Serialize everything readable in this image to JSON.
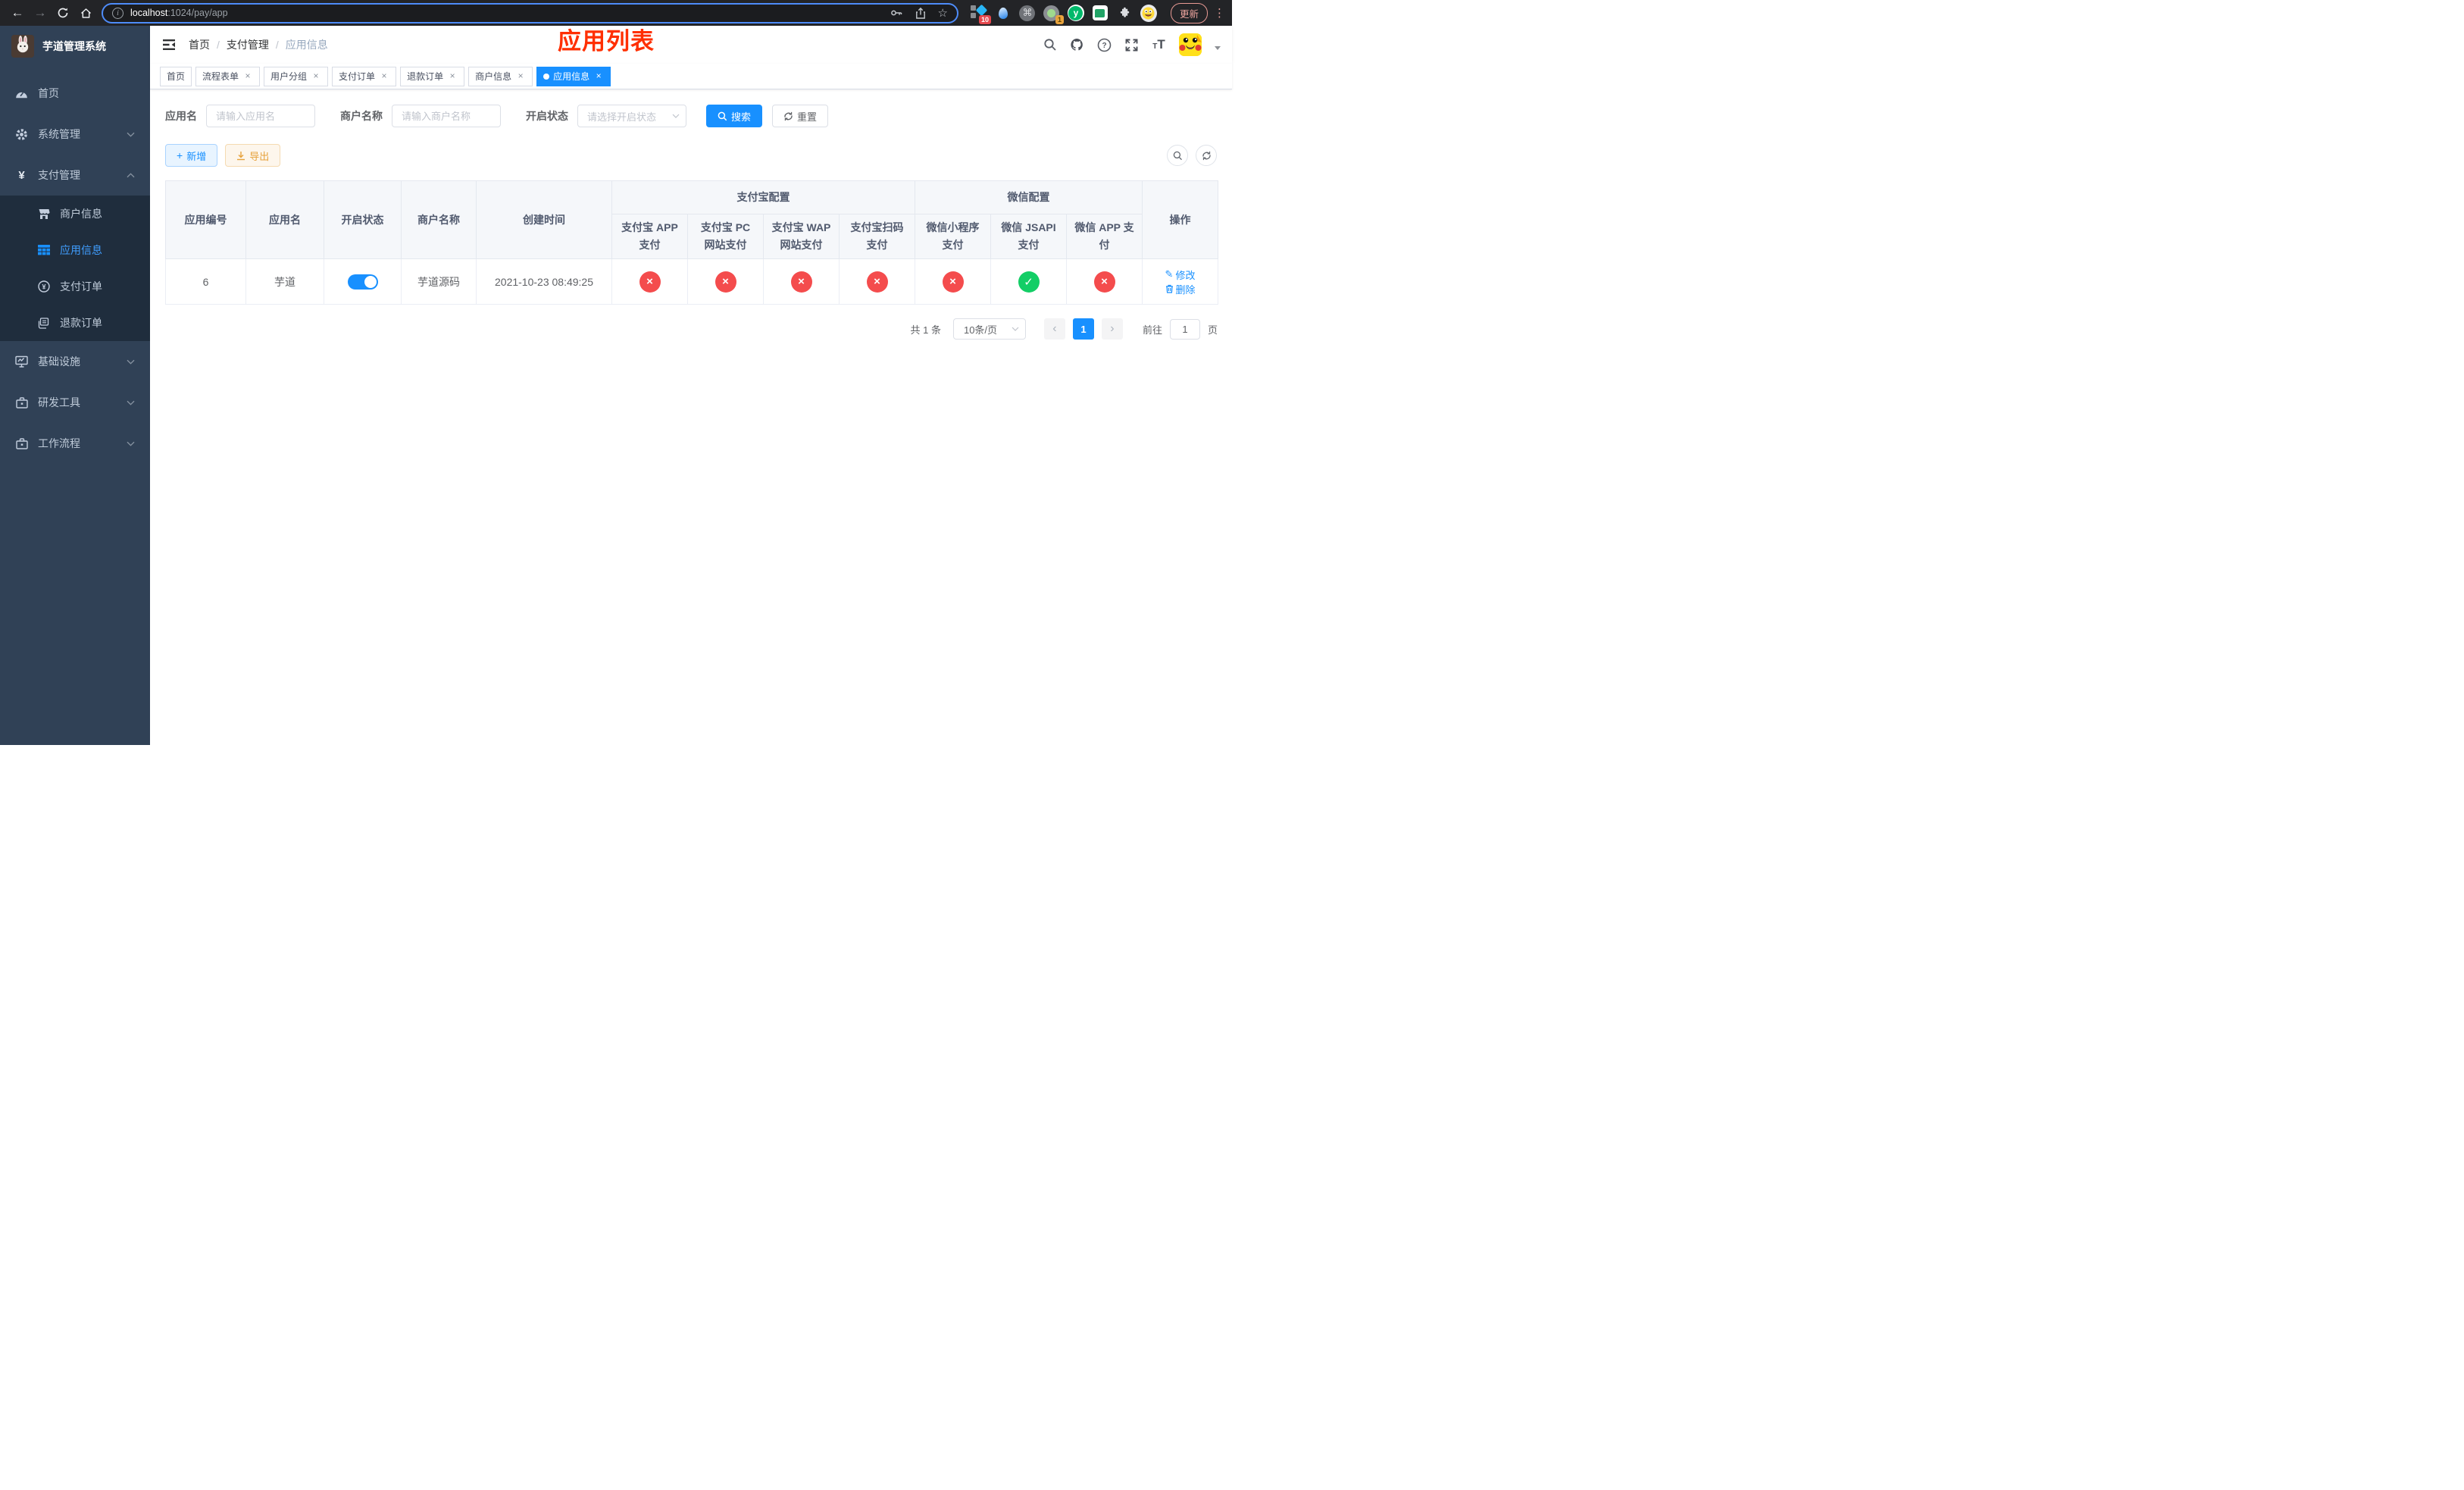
{
  "colors": {
    "accent": "#1890ff",
    "sidebar_bg": "#304156",
    "submenu_bg": "#1f2d3d",
    "danger": "#f44c4d",
    "success": "#13ce66",
    "warning": "#e6a23c",
    "overlay_title_red": "#ff2f00"
  },
  "browser": {
    "url_host": "localhost",
    "url_path": ":1024/pay/app",
    "update_label": "更新",
    "ext_badge_count": "10",
    "ext_dot_count": "1",
    "ext_y_label": "y"
  },
  "sidebar": {
    "title": "芋道管理系统",
    "items": [
      {
        "label": "首页"
      },
      {
        "label": "系统管理"
      },
      {
        "label": "支付管理"
      },
      {
        "label": "基础设施"
      },
      {
        "label": "研发工具"
      },
      {
        "label": "工作流程"
      }
    ],
    "submenu": [
      {
        "label": "商户信息"
      },
      {
        "label": "应用信息"
      },
      {
        "label": "支付订单"
      },
      {
        "label": "退款订单"
      }
    ]
  },
  "navbar": {
    "breadcrumb": [
      {
        "label": "首页"
      },
      {
        "label": "支付管理"
      },
      {
        "label": "应用信息"
      }
    ],
    "overlay_title": "应用列表"
  },
  "tags": [
    {
      "label": "首页"
    },
    {
      "label": "流程表单"
    },
    {
      "label": "用户分组"
    },
    {
      "label": "支付订单"
    },
    {
      "label": "退款订单"
    },
    {
      "label": "商户信息"
    },
    {
      "label": "应用信息"
    }
  ],
  "icons": {
    "close": "×",
    "cross": "×",
    "check": "✓",
    "prev": "‹",
    "next": "›",
    "back": "←",
    "forward": "→",
    "star": "☆",
    "command": "⌘",
    "kebab": "⋮",
    "plus": "＋",
    "info": "i",
    "question": "?",
    "edit": "✎"
  },
  "filter": {
    "app_name_label": "应用名",
    "app_name_placeholder": "请输入应用名",
    "merchant_label": "商户名称",
    "merchant_placeholder": "请输入商户名称",
    "status_label": "开启状态",
    "status_placeholder": "请选择开启状态",
    "search_label": "搜索",
    "reset_label": "重置"
  },
  "toolbar": {
    "add_label": "新增",
    "export_label": "导出"
  },
  "table": {
    "columns": {
      "id": "应用编号",
      "name": "应用名",
      "status": "开启状态",
      "merchant": "商户名称",
      "created": "创建时间",
      "alipay_group": "支付宝配置",
      "wechat_group": "微信配置",
      "actions": "操作",
      "alipay_app": "支付宝 APP 支付",
      "alipay_pc": "支付宝 PC 网站支付",
      "alipay_wap": "支付宝 WAP 网站支付",
      "alipay_qr": "支付宝扫码支付",
      "wx_lite": "微信小程序支付",
      "wx_jsapi": "微信 JSAPI 支付",
      "wx_app": "微信 APP 支付"
    },
    "row": {
      "id": "6",
      "name": "芋道",
      "switch_on": true,
      "merchant": "芋道源码",
      "created": "2021-10-23 08:49:25",
      "status_icons": [
        "×",
        "×",
        "×",
        "×",
        "×",
        "✓",
        "×"
      ]
    },
    "actions": {
      "edit": "修改",
      "delete": "删除"
    }
  },
  "pagination": {
    "total": "共 1 条",
    "page_size": "10条/页",
    "page": "1",
    "goto_label": "前往",
    "goto_value": "1",
    "page_unit": "页"
  }
}
